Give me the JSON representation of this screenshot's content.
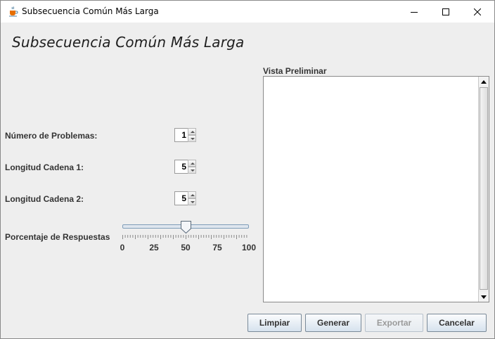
{
  "window": {
    "title": "Subsecuencia Común Más Larga",
    "icon": "java-coffee-cup-icon",
    "controls": [
      "minimize-icon",
      "maximize-icon",
      "close-icon"
    ]
  },
  "heading": "Subsecuencia Común Más Larga",
  "form": {
    "num_problems": {
      "label": "Número de Problemas:",
      "value": "1"
    },
    "length_1": {
      "label": "Longitud Cadena 1:",
      "value": "5"
    },
    "length_2": {
      "label": "Longitud Cadena 2:",
      "value": "5"
    },
    "answer_pct": {
      "label": "Porcentaje de Respuestas",
      "value": 50,
      "min": 0,
      "max": 100,
      "tick_labels": [
        "0",
        "25",
        "50",
        "75",
        "100"
      ]
    }
  },
  "preview": {
    "label": "Vista Preliminar",
    "content": ""
  },
  "buttons": {
    "clear": "Limpiar",
    "generate": "Generar",
    "export": "Exportar",
    "cancel": "Cancelar"
  },
  "colors": {
    "accent_border": "#7f9db9",
    "disabled_text": "#9a9a9a",
    "background": "#eeeeee"
  }
}
